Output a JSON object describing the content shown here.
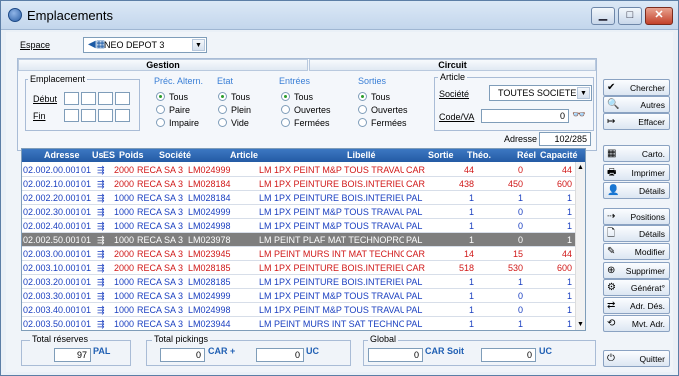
{
  "window": {
    "title": "Emplacements"
  },
  "espace": {
    "label": "Espace",
    "value": "NEO DEPOT 3"
  },
  "tabs": {
    "gestion": "Gestion",
    "circuit": "Circuit"
  },
  "emplacement": {
    "title": "Emplacement",
    "debut": "Début",
    "fin": "Fin"
  },
  "groups": {
    "alt": {
      "title": "Préc. Altern.",
      "opts": [
        "Tous",
        "Paire",
        "Impaire"
      ]
    },
    "etat": {
      "title": "Etat",
      "opts": [
        "Tous",
        "Plein",
        "Vide"
      ]
    },
    "entrees": {
      "title": "Entrées",
      "opts": [
        "Tous",
        "Ouvertes",
        "Fermées"
      ]
    },
    "sorties": {
      "title": "Sorties",
      "opts": [
        "Tous",
        "Ouvertes",
        "Fermées"
      ]
    }
  },
  "article": {
    "title": "Article",
    "societe_label": "Société",
    "societe_value": "TOUTES SOCIETES",
    "codeva_label": "Code/VA",
    "codeva_count": "0",
    "adresse_label": "Adresse",
    "adresse_value": "102/285"
  },
  "grid": {
    "headers": [
      "Adresse",
      "Us",
      "ES",
      "Poids",
      "Société",
      "Article",
      "Libellé",
      "Sortie",
      "Théo.",
      "Réel",
      "Capacité"
    ],
    "rows": [
      [
        "02.002.00.001",
        "01",
        "2000",
        "RECA SA 3",
        "LM024999",
        "LM 1PX PEINT M&P TOUS TRAVAU",
        "CAR",
        "44",
        "0",
        "44",
        "red"
      ],
      [
        "02.002.10.001",
        "01",
        "2000",
        "RECA SA 3",
        "LM028184",
        "LM 1PX PEINTURE BOIS.INTERIEU",
        "CAR",
        "438",
        "450",
        "600",
        "red"
      ],
      [
        "02.002.20.001",
        "01",
        "1000",
        "RECA SA 3",
        "LM028184",
        "LM 1PX PEINTURE BOIS.INTERIEU",
        "PAL",
        "1",
        "1",
        "1",
        "blue"
      ],
      [
        "02.002.30.001",
        "01",
        "1000",
        "RECA SA 3",
        "LM024999",
        "LM 1PX PEINT M&P TOUS TRAVAU",
        "PAL",
        "1",
        "0",
        "1",
        "blue"
      ],
      [
        "02.002.40.001",
        "01",
        "1000",
        "RECA SA 3",
        "LM024998",
        "LM 1PX PEINT M&P TOUS TRAVAU",
        "PAL",
        "1",
        "0",
        "1",
        "blue"
      ],
      [
        "02.002.50.001",
        "01",
        "1000",
        "RECA SA 3",
        "LM023978",
        "LM PEINT PLAF MAT TECHNOPRO",
        "PAL",
        "1",
        "0",
        "1",
        "sel"
      ],
      [
        "02.003.00.001",
        "01",
        "2000",
        "RECA SA 3",
        "LM023945",
        "LM PEINT MURS INT MAT TECHNC",
        "CAR",
        "14",
        "15",
        "44",
        "red"
      ],
      [
        "02.003.10.001",
        "01",
        "2000",
        "RECA SA 3",
        "LM028185",
        "LM 1PX PEINTURE BOIS.INTERIEU",
        "CAR",
        "518",
        "530",
        "600",
        "red"
      ],
      [
        "02.003.20.001",
        "01",
        "1000",
        "RECA SA 3",
        "LM028185",
        "LM 1PX PEINTURE BOIS.INTERIEU",
        "PAL",
        "1",
        "1",
        "1",
        "blue"
      ],
      [
        "02.003.30.001",
        "01",
        "1000",
        "RECA SA 3",
        "LM024999",
        "LM 1PX PEINT M&P TOUS TRAVAU",
        "PAL",
        "1",
        "0",
        "1",
        "blue"
      ],
      [
        "02.003.40.001",
        "01",
        "1000",
        "RECA SA 3",
        "LM024998",
        "LM 1PX PEINT M&P TOUS TRAVAU",
        "PAL",
        "1",
        "0",
        "1",
        "blue"
      ],
      [
        "02.003.50.001",
        "01",
        "1000",
        "RECA SA 3",
        "LM023944",
        "LM PEINT MURS INT SAT TECHNO",
        "PAL",
        "1",
        "1",
        "1",
        "blue"
      ]
    ]
  },
  "buttons": [
    "Chercher",
    "Autres",
    "Effacer",
    "Carto.",
    "Imprimer",
    "Détails",
    "Positions",
    "Détails",
    "Modifier",
    "Supprimer",
    "Générat°",
    "Adr. Dés.",
    "Mvt. Adr.",
    "Quitter"
  ],
  "totals": {
    "reserves": {
      "title": "Total réserves",
      "value": "97",
      "unit": "PAL"
    },
    "pickings": {
      "title": "Total pickings",
      "car": "0",
      "car_unit": "CAR +",
      "uc": "0",
      "uc_unit": "UC"
    },
    "global": {
      "title": "Global",
      "car": "0",
      "car_unit": "CAR Soit",
      "uc": "0",
      "uc_unit": "UC"
    }
  }
}
